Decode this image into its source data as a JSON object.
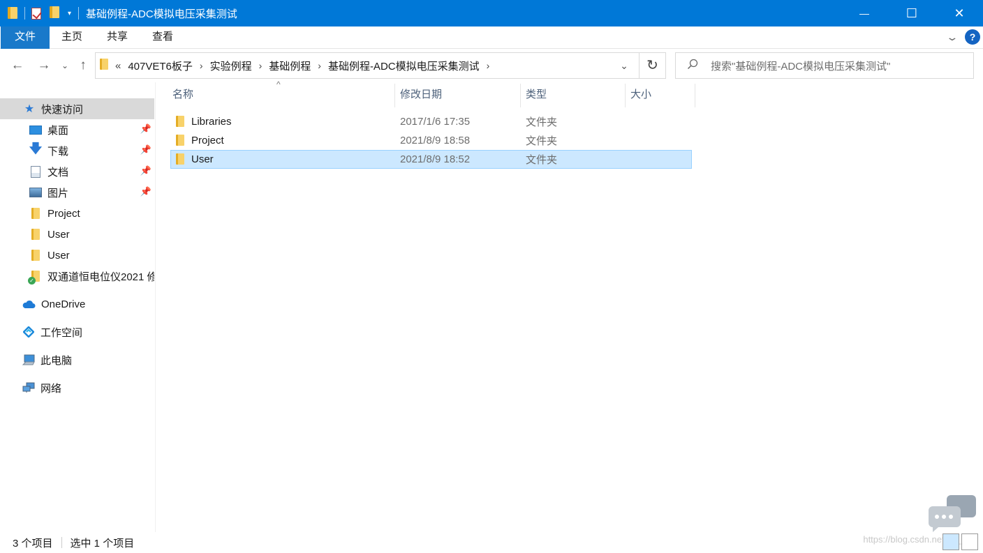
{
  "window": {
    "title": "基础例程-ADC模拟电压采集测试",
    "controls": {
      "minimize": "—",
      "maximize": "☐",
      "close": "✕"
    }
  },
  "ribbon": {
    "tabs": [
      "文件",
      "主页",
      "共享",
      "查看"
    ],
    "help": "?"
  },
  "address": {
    "overflow": "«",
    "crumbs": [
      "407VET6板子",
      "实验例程",
      "基础例程",
      "基础例程-ADC模拟电压采集测试"
    ]
  },
  "search": {
    "placeholder": "搜索\"基础例程-ADC模拟电压采集测试\""
  },
  "sidebar": {
    "quick_access": "快速访问",
    "items": [
      {
        "label": "桌面",
        "icon": "desktop-icon",
        "pinned": true
      },
      {
        "label": "下载",
        "icon": "download-icon",
        "pinned": true
      },
      {
        "label": "文档",
        "icon": "document-icon",
        "pinned": true
      },
      {
        "label": "图片",
        "icon": "pictures-icon",
        "pinned": true
      },
      {
        "label": "Project",
        "icon": "folder-icon",
        "pinned": false
      },
      {
        "label": "User",
        "icon": "folder-icon",
        "pinned": false
      },
      {
        "label": "User",
        "icon": "folder-icon",
        "pinned": false
      },
      {
        "label": "双通道恒电位仪2021 修",
        "icon": "folder-synced-icon",
        "pinned": false
      }
    ],
    "onedrive": "OneDrive",
    "workspace": "工作空间",
    "this_pc": "此电脑",
    "network": "网络"
  },
  "columns": {
    "name": "名称",
    "date": "修改日期",
    "type": "类型",
    "size": "大小"
  },
  "files": [
    {
      "name": "Libraries",
      "date": "2017/1/6 17:35",
      "type": "文件夹",
      "selected": false
    },
    {
      "name": "Project",
      "date": "2021/8/9 18:58",
      "type": "文件夹",
      "selected": false
    },
    {
      "name": "User",
      "date": "2021/8/9 18:52",
      "type": "文件夹",
      "selected": true
    }
  ],
  "status": {
    "count": "3 个项目",
    "selected": "选中 1 个项目"
  },
  "watermark": "https://blog.csdn.net/qq_"
}
